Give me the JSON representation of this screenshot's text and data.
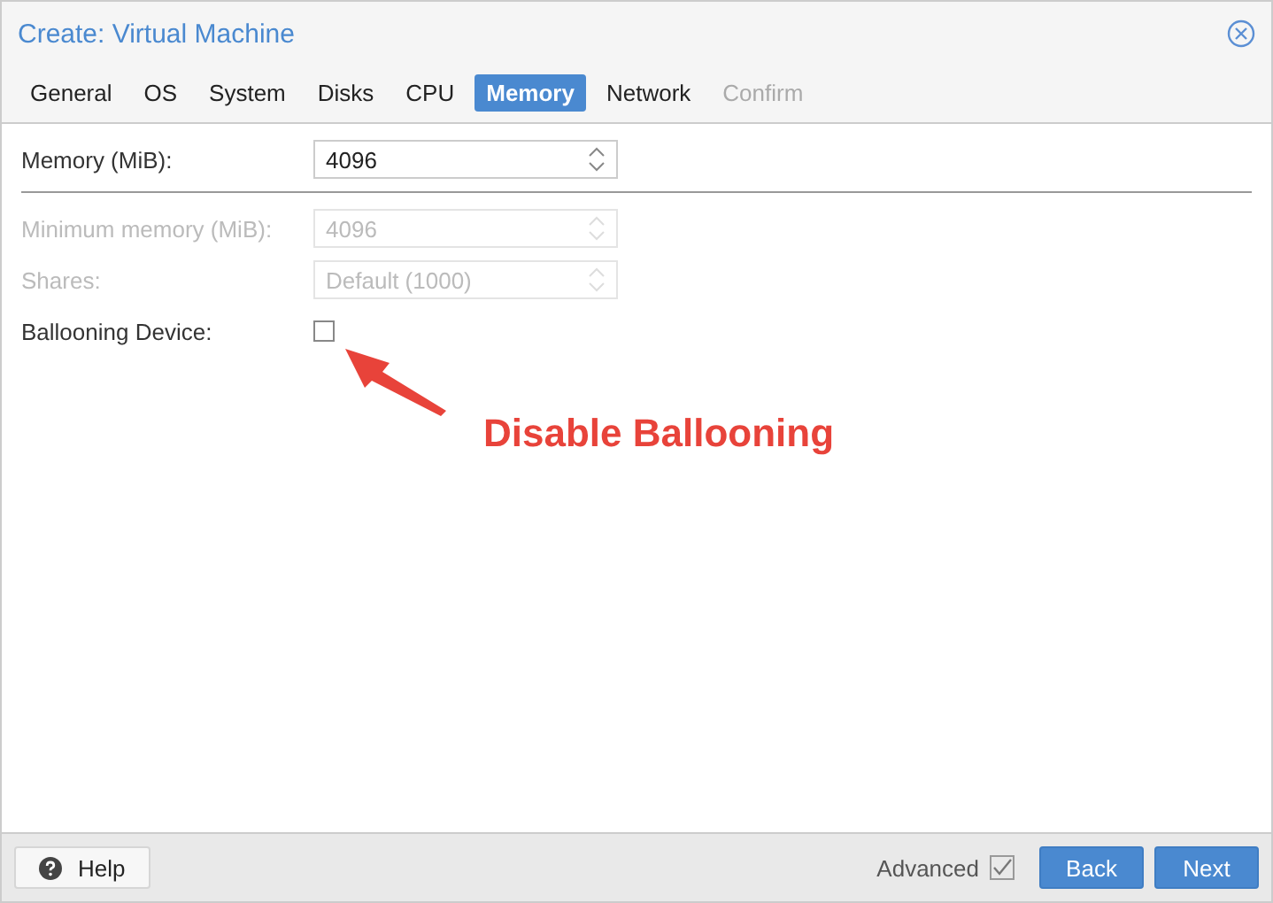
{
  "window": {
    "title": "Create: Virtual Machine"
  },
  "tabs": [
    {
      "label": "General",
      "selected": false,
      "disabled": false
    },
    {
      "label": "OS",
      "selected": false,
      "disabled": false
    },
    {
      "label": "System",
      "selected": false,
      "disabled": false
    },
    {
      "label": "Disks",
      "selected": false,
      "disabled": false
    },
    {
      "label": "CPU",
      "selected": false,
      "disabled": false
    },
    {
      "label": "Memory",
      "selected": true,
      "disabled": false
    },
    {
      "label": "Network",
      "selected": false,
      "disabled": false
    },
    {
      "label": "Confirm",
      "selected": false,
      "disabled": true
    }
  ],
  "fields": [
    {
      "kind": "spinner",
      "label": "Memory (MiB):",
      "value": "4096",
      "disabled": false
    },
    {
      "kind": "divider"
    },
    {
      "kind": "spinner",
      "label": "Minimum memory (MiB):",
      "value": "4096",
      "disabled": true
    },
    {
      "kind": "spinner",
      "label": "Shares:",
      "value": "Default (1000)",
      "disabled": true
    },
    {
      "kind": "checkbox",
      "label": "Ballooning Device:",
      "checked": false
    }
  ],
  "annotation": {
    "text": "Disable Ballooning"
  },
  "footer": {
    "help": "Help",
    "advanced": {
      "label": "Advanced",
      "checked": true
    },
    "buttons": [
      "Back",
      "Next"
    ]
  }
}
